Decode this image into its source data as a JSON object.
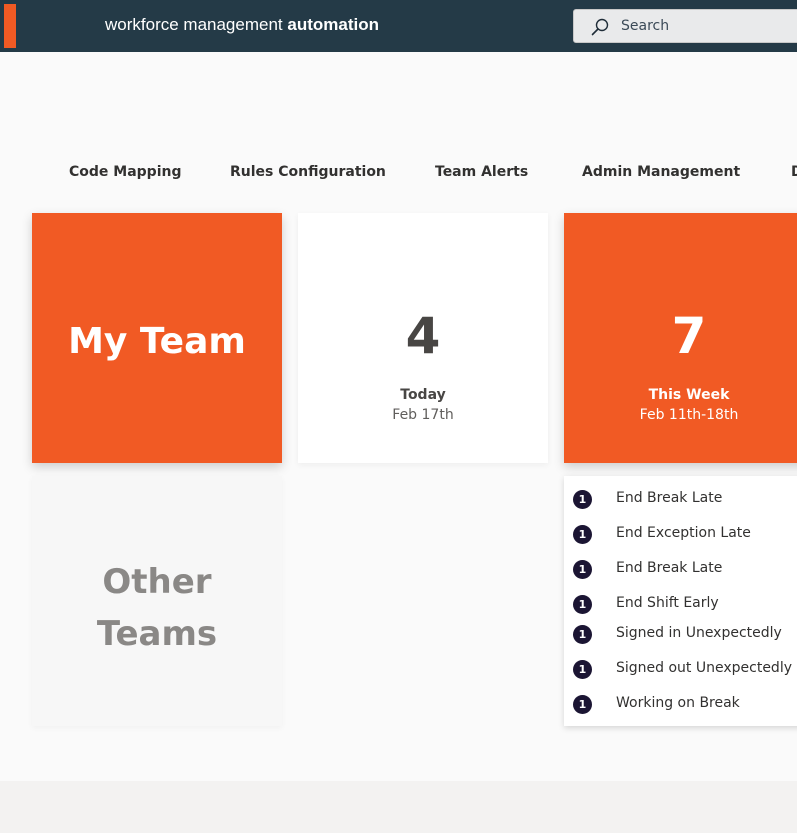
{
  "header": {
    "brand_light": "workforce management ",
    "brand_bold": "automation",
    "search_placeholder": "Search",
    "icons": {
      "search": "search-icon"
    },
    "colors": {
      "bar": "#243a47",
      "accent": "#f15a24"
    }
  },
  "nav": {
    "items": [
      {
        "label": "Code Mapping"
      },
      {
        "label": "Rules Configuration"
      },
      {
        "label": "Team Alerts"
      },
      {
        "label": "Admin Management"
      },
      {
        "label": "D"
      }
    ]
  },
  "tiles": {
    "my_team": {
      "label": "My Team"
    },
    "today": {
      "count": "4",
      "caption": "Today",
      "date": "Feb 17th"
    },
    "this_week": {
      "count": "7",
      "caption": "This Week",
      "date": "Feb 11th-18th"
    },
    "other_teams": {
      "line1": "Other",
      "line2": "Teams"
    }
  },
  "alerts": {
    "items": [
      {
        "count": "1",
        "label": "End Break Late"
      },
      {
        "count": "1",
        "label": "End Exception Late"
      },
      {
        "count": "1",
        "label": "End Break Late"
      },
      {
        "count": "1",
        "label": "End Shift Early"
      },
      {
        "count": "1",
        "label": "Signed in Unexpectedly"
      },
      {
        "count": "1",
        "label": "Signed out Unexpectedly"
      },
      {
        "count": "1",
        "label": "Working on Break"
      }
    ]
  },
  "colors": {
    "orange": "#f15a24",
    "badge": "#1b1533"
  }
}
